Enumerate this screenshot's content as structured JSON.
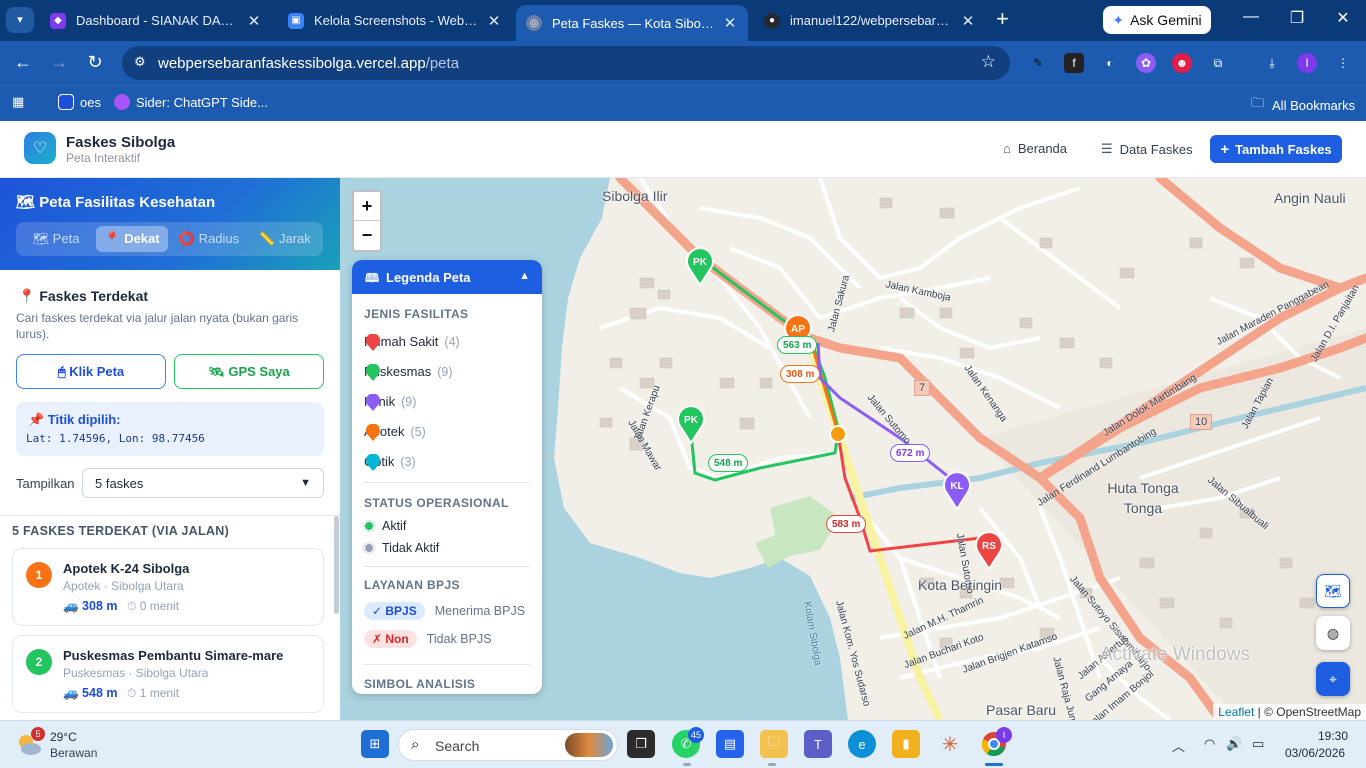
{
  "browser": {
    "tabs": [
      {
        "title": "Dashboard - SIANAK DARA | Po",
        "active": false
      },
      {
        "title": "Kelola Screenshots - Website Pe",
        "active": false
      },
      {
        "title": "Peta Faskes — Kota Sibolga",
        "active": true
      },
      {
        "title": "imanuel122/webpersebaranfask",
        "active": false
      }
    ],
    "gemini_label": "Ask Gemini",
    "url_host": "webpersebaranfaskessibolga.vercel.app",
    "url_path": "/peta",
    "bookmarks": [
      {
        "label": "oes"
      },
      {
        "label": "Sider: ChatGPT Side..."
      }
    ],
    "all_bookmarks": "All Bookmarks",
    "profile_initial": "I"
  },
  "app": {
    "brand": "Faskes Sibolga",
    "brand_sub": "Peta Interaktif",
    "nav": {
      "home": "Beranda",
      "data": "Data Faskes",
      "add": "Tambah Faskes"
    }
  },
  "sidebar": {
    "title": "🗺 Peta Fasilitas Kesehatan",
    "tabs": [
      {
        "label": "🗺 Peta",
        "active": false
      },
      {
        "label": "📍 Dekat",
        "active": true
      },
      {
        "label": "⭕ Radius",
        "active": false
      },
      {
        "label": "📏 Jarak",
        "active": false
      }
    ],
    "section_title": "📍 Faskes Terdekat",
    "section_desc": "Cari faskes terdekat via jalur jalan nyata (bukan garis lurus).",
    "btn_click_map": "🖱 Klik Peta",
    "btn_gps": "🛰 GPS Saya",
    "picked_label": "📌 Titik dipilih:",
    "picked_value": "Lat: 1.74596, Lon: 98.77456",
    "show_label": "Tampilkan",
    "show_value": "5 faskes",
    "list_heading": "5 FASKES TERDEKAT (VIA JALAN)",
    "results": [
      {
        "rank": "1",
        "name": "Apotek K-24 Sibolga",
        "sub": "Apotek · Sibolga Utara",
        "distance": "308 m",
        "time": "0 menit",
        "color": "#f97316"
      },
      {
        "rank": "2",
        "name": "Puskesmas Pembantu Simare-mare",
        "sub": "Puskesmas · Sibolga Utara",
        "distance": "548 m",
        "time": "1 menit",
        "color": "#22c55e"
      }
    ]
  },
  "legend": {
    "title": "Legenda Peta",
    "types_heading": "JENIS FASILITAS",
    "types": [
      {
        "label": "Rumah Sakit",
        "count": "(4)",
        "color": "#ef4444"
      },
      {
        "label": "Puskesmas",
        "count": "(9)",
        "color": "#22c55e"
      },
      {
        "label": "Klinik",
        "count": "(9)",
        "color": "#8b5cf6"
      },
      {
        "label": "Apotek",
        "count": "(5)",
        "color": "#f97316"
      },
      {
        "label": "Optik",
        "count": "(3)",
        "color": "#06b6d4"
      }
    ],
    "status_heading": "STATUS OPERASIONAL",
    "status": [
      {
        "label": "Aktif",
        "color": "#22c55e"
      },
      {
        "label": "Tidak Aktif",
        "color": "#94a3b8"
      }
    ],
    "bpjs_heading": "LAYANAN BPJS",
    "bpjs": [
      {
        "badge": "✓ BPJS",
        "label": "Menerima BPJS"
      },
      {
        "badge": "✗ Non",
        "label": "Tidak BPJS"
      }
    ],
    "analysis_heading": "SIMBOL ANALISIS"
  },
  "map": {
    "places": [
      "Sibolga Ilir",
      "Angin Nauli",
      "Huta Tonga Tonga",
      "Kota Beringin",
      "Pasar Baru"
    ],
    "streets": [
      "Jalan Kamboja",
      "Jalan Sakura",
      "Jalan Kerapu",
      "Jalan Mawar",
      "Jalan Sutomo",
      "Jalan Kenanga",
      "Jalan Dolok Martimbang",
      "Jalan Ferdinand Lumbantobing",
      "Jalan Maraden Panggabean",
      "Jalan D.I. Panjaitan",
      "Jalan Tapian",
      "Jalan Sibualbuali",
      "Jalan M.H. Thamrin",
      "Jalan Buchari Koto",
      "Jalan Brigjen Katamso",
      "Jalan Sutoyo Siswomiharjo",
      "Jalan Kom. Yos Sudarso",
      "Jalan Albertus",
      "Gang Arnaya",
      "Jalan Imam Bonjol",
      "Jalan Raja Junjungan",
      "Jalan Sutomo",
      "Kolam Sibolga"
    ],
    "road_numbers": [
      "7",
      "10"
    ],
    "markers": [
      {
        "code": "PK",
        "color": "#22c55e"
      },
      {
        "code": "AP",
        "color": "#f97316"
      },
      {
        "code": "PK",
        "color": "#22c55e"
      },
      {
        "code": "KL",
        "color": "#8b5cf6"
      },
      {
        "code": "RS",
        "color": "#ef4444"
      }
    ],
    "route_labels": [
      {
        "text": "563 m",
        "color": "#22c55e"
      },
      {
        "text": "308 m",
        "color": "#f97316"
      },
      {
        "text": "548 m",
        "color": "#22c55e"
      },
      {
        "text": "672 m",
        "color": "#8b5cf6"
      },
      {
        "text": "583 m",
        "color": "#ef4444"
      }
    ],
    "attribution_leaflet": "Leaflet",
    "attribution_osm": "| © OpenStreetMap",
    "watermark": "Activate Windows"
  },
  "taskbar": {
    "weather_temp": "29°C",
    "weather_desc": "Berawan",
    "weather_badge": "5",
    "search": "Search",
    "whatsapp_badge": "45",
    "chrome_badge": "I",
    "time": "19:30",
    "date": "03/06/2026"
  }
}
